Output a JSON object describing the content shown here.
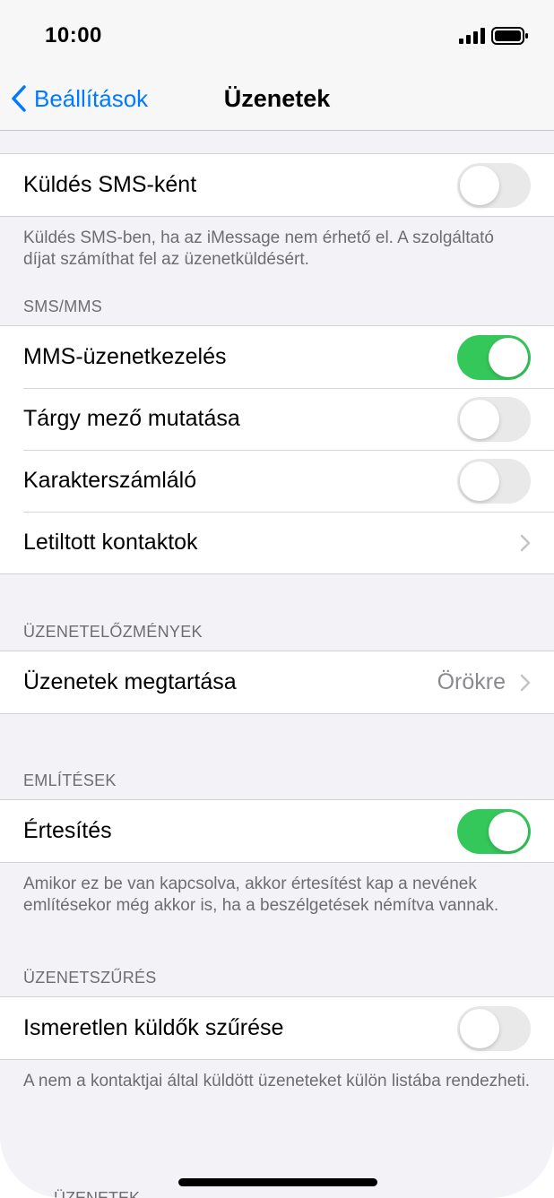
{
  "status_bar": {
    "time": "10:00"
  },
  "nav": {
    "back_label": "Beállítások",
    "title": "Üzenetek"
  },
  "send_as_sms": {
    "label": "Küldés SMS-ként",
    "enabled": false,
    "footer": "Küldés SMS-ben, ha az iMessage nem érhető el. A szolgáltató díjat számíthat fel az üzenetküldésért."
  },
  "sms_mms": {
    "header": "SMS/MMS",
    "items": [
      {
        "label": "MMS-üzenetkezelés",
        "type": "toggle",
        "enabled": true
      },
      {
        "label": "Tárgy mező mutatása",
        "type": "toggle",
        "enabled": false
      },
      {
        "label": "Karakterszámláló",
        "type": "toggle",
        "enabled": false
      },
      {
        "label": "Letiltott kontaktok",
        "type": "link"
      }
    ]
  },
  "message_history": {
    "header": "ÜZENETELŐZMÉNYEK",
    "keep_messages_label": "Üzenetek megtartása",
    "keep_messages_value": "Örökre"
  },
  "mentions": {
    "header": "EMLÍTÉSEK",
    "notify_label": "Értesítés",
    "notify_enabled": true,
    "footer": "Amikor ez be van kapcsolva, akkor értesítést kap a nevének említésekor még akkor is, ha a beszélgetések némítva vannak."
  },
  "message_filtering": {
    "header": "ÜZENETSZŰRÉS",
    "filter_unknown_label": "Ismeretlen küldők szűrése",
    "filter_unknown_enabled": false,
    "footer": "A nem a kontaktjai által küldött üzeneteket külön listába rendezheti."
  },
  "peek_header": "ÜZENETEK",
  "colors": {
    "accent": "#007aff",
    "toggle_on": "#34c759",
    "toggle_off": "#e9e9ea",
    "background": "#f2f2f7"
  }
}
